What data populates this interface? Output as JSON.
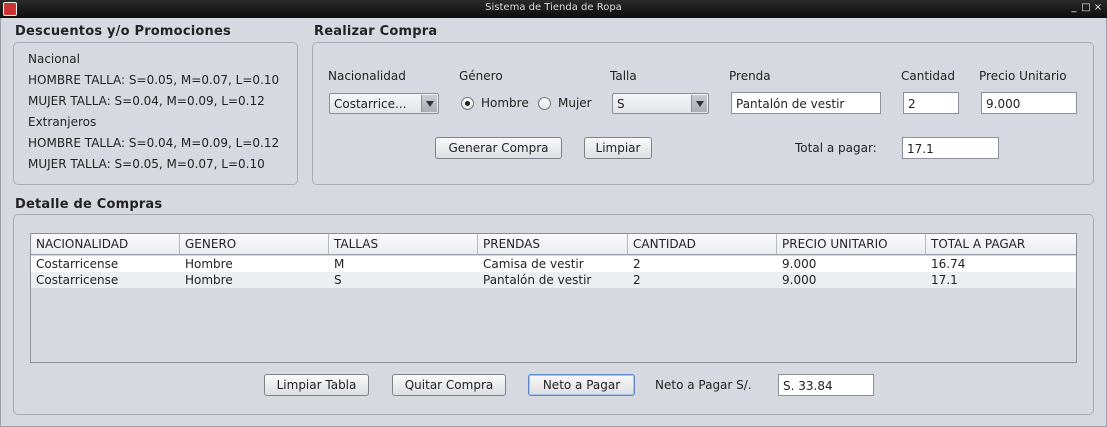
{
  "window": {
    "title": "Sistema de Tienda de Ropa",
    "controls": [
      "_",
      "□",
      "×"
    ]
  },
  "promos": {
    "section_title": "Descuentos y/o Promociones",
    "lines": [
      "Nacional",
      "HOMBRE TALLA: S=0.05, M=0.07, L=0.10",
      "MUJER TALLA: S=0.04, M=0.09, L=0.12",
      "Extranjeros",
      "HOMBRE TALLA: S=0.04, M=0.09, L=0.12",
      "MUJER TALLA: S=0.05, M=0.07, L=0.10"
    ]
  },
  "compra": {
    "section_title": "Realizar Compra",
    "nacionalidad_label": "Nacionalidad",
    "nacionalidad_value": "Costarrice...",
    "genero_label": "Género",
    "genero_options": [
      "Hombre",
      "Mujer"
    ],
    "genero_selected": "Hombre",
    "talla_label": "Talla",
    "talla_value": "S",
    "prenda_label": "Prenda",
    "prenda_value": "Pantalón de vestir",
    "cantidad_label": "Cantidad",
    "cantidad_value": "2",
    "precio_label": "Precio Unitario",
    "precio_value": "9.000",
    "generar_button": "Generar Compra",
    "limpiar_button": "Limpiar",
    "total_label": "Total a pagar:",
    "total_value": "17.1"
  },
  "detalle": {
    "section_title": "Detalle de Compras",
    "columns": [
      "NACIONALIDAD",
      "GENERO",
      "TALLAS",
      "PRENDAS",
      "CANTIDAD",
      "PRECIO UNITARIO",
      "TOTAL A PAGAR"
    ],
    "rows": [
      [
        "Costarricense",
        "Hombre",
        "M",
        "Camisa de vestir",
        "2",
        "9.000",
        "16.74"
      ],
      [
        "Costarricense",
        "Hombre",
        "S",
        "Pantalón de vestir",
        "2",
        "9.000",
        "17.1"
      ]
    ],
    "limpiar_tabla_button": "Limpiar Tabla",
    "quitar_button": "Quitar Compra",
    "neto_button": "Neto a Pagar",
    "neto_label": "Neto a Pagar S/.",
    "neto_value": "S. 33.84"
  }
}
